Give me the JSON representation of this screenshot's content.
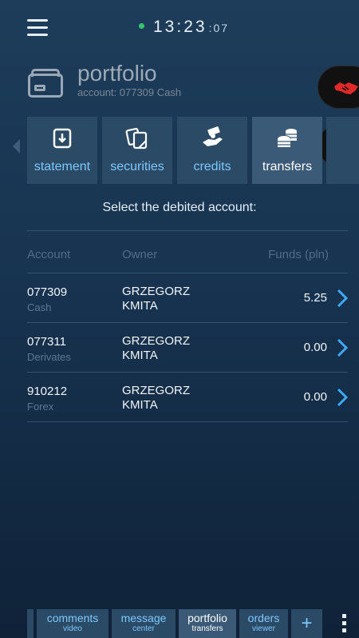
{
  "status": {
    "clock_main": "13:23",
    "clock_seconds": ":07"
  },
  "header": {
    "title": "portfolio",
    "account_line": "account: 077309 Cash"
  },
  "tabs": [
    {
      "label": "statement",
      "icon": "statement-icon"
    },
    {
      "label": "securities",
      "icon": "securities-icon"
    },
    {
      "label": "credits",
      "icon": "credits-icon"
    },
    {
      "label": "transfers",
      "icon": "transfers-icon",
      "active": true
    }
  ],
  "prompt": "Select the debited account:",
  "table": {
    "headers": {
      "account": "Account",
      "owner": "Owner",
      "funds": "Funds (pln)"
    },
    "rows": [
      {
        "account": "077309",
        "type": "Cash",
        "owner_first": "GRZEGORZ",
        "owner_last": "KMITA",
        "funds": "5.25"
      },
      {
        "account": "077311",
        "type": "Derivates",
        "owner_first": "GRZEGORZ",
        "owner_last": "KMITA",
        "funds": "0.00"
      },
      {
        "account": "910212",
        "type": "Forex",
        "owner_first": "GRZEGORZ",
        "owner_last": "KMITA",
        "funds": "0.00"
      }
    ]
  },
  "bottom_nav": [
    {
      "main": "comments",
      "sub": "video"
    },
    {
      "main": "message",
      "sub": "center"
    },
    {
      "main": "portfolio",
      "sub": "transfers",
      "active": true
    },
    {
      "main": "orders",
      "sub": "viewer"
    }
  ],
  "plus_label": "+",
  "colors": {
    "accent": "#7ec8ff",
    "online_dot": "#36c46b",
    "deals_red": "#e02a2a",
    "chevron": "#3fa9f5"
  }
}
